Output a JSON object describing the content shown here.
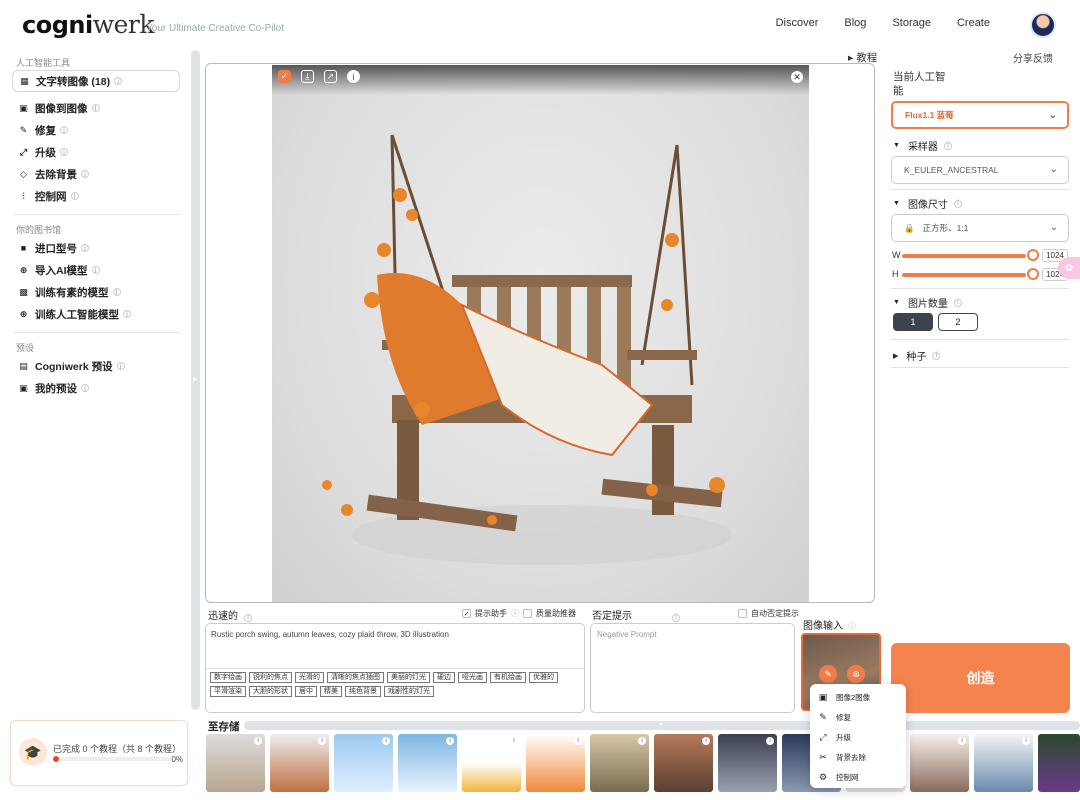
{
  "header": {
    "logo_bold": "cogni",
    "logo_light": "werk",
    "tagline": "Your Ultimate Creative Co-Pilot",
    "nav": [
      "Discover",
      "Blog",
      "Storage",
      "Create"
    ]
  },
  "sidebar": {
    "sections": [
      {
        "title": "人工智能工具",
        "items": [
          {
            "label": "文字转图像 (18)",
            "icon": "text-to-image-icon",
            "active": true
          },
          {
            "label": "图像到图像",
            "icon": "image-icon"
          },
          {
            "label": "修复",
            "icon": "brush-icon"
          },
          {
            "label": "升级",
            "icon": "upscale-icon"
          },
          {
            "label": "去除背景",
            "icon": "eraser-icon"
          },
          {
            "label": "控制网",
            "icon": "sliders-icon"
          }
        ]
      },
      {
        "title": "你的图书馆",
        "items": [
          {
            "label": "进口型号",
            "icon": "import-icon"
          },
          {
            "label": "导入AI模型",
            "icon": "plus-circle-icon"
          },
          {
            "label": "训练有素的模型",
            "icon": "model-icon"
          },
          {
            "label": "训练人工智能模型",
            "icon": "plus-circle-icon"
          }
        ]
      },
      {
        "title": "预设",
        "items": [
          {
            "label": "Cogniwerk 预设",
            "icon": "preset-icon"
          },
          {
            "label": "我的预设",
            "icon": "user-icon"
          }
        ]
      }
    ],
    "progress": {
      "text": "已完成 0 个教程（共 8 个教程）",
      "percent_label": "0%",
      "percent": 0
    }
  },
  "canvas": {
    "tutorial": "教程",
    "tools": [
      "check-icon",
      "download-icon",
      "share-icon",
      "info-icon"
    ]
  },
  "right_panel": {
    "feedback": "分享反馈",
    "current_model_label": "当前人工智能",
    "model_value": "Flux1.1 蓝莓",
    "sampler_label": "采样器",
    "sampler_value": "K_EULER_ANCESTRAL",
    "size_label": "图像尺寸",
    "size_value": "正方形、1:1",
    "width_label": "W",
    "width_value": "1024",
    "height_label": "H",
    "height_value": "1024",
    "count_label": "图片数量",
    "count_options": [
      "1",
      "2"
    ],
    "seed_label": "种子",
    "create_label": "创造"
  },
  "prompt": {
    "label": "迅速的",
    "assistant_label": "提示助手",
    "enhancer_label": "质量助推器",
    "text": "Rustic porch swing, autumn leaves, cozy plaid throw, 3D illustration",
    "tags": [
      "数字绘画",
      "锐利的焦点",
      "光滑的",
      "清晰的焦点插图",
      "美丽的灯光",
      "硬边",
      "哑光画",
      "有机绘画",
      "优雅的",
      "平滑渲染",
      "大胆的形状",
      "居中",
      "精美",
      "纯色背景",
      "戏剧性的灯光"
    ]
  },
  "negative": {
    "label": "否定提示",
    "auto_label": "自动否定提示",
    "placeholder": "Negative Prompt"
  },
  "image_input": {
    "label": "图像输入"
  },
  "context_menu": {
    "items": [
      {
        "label": "图像2图像",
        "icon": "image-icon"
      },
      {
        "label": "修复",
        "icon": "brush-icon"
      },
      {
        "label": "升级",
        "icon": "upscale-icon"
      },
      {
        "label": "背景去除",
        "icon": "scissors-icon"
      },
      {
        "label": "控制网",
        "icon": "gear-icon"
      }
    ]
  },
  "storage": {
    "label": "至存储"
  },
  "colors": {
    "accent": "#f07c4a",
    "create_button": "#f4834e",
    "dark_button": "#3c434c"
  }
}
